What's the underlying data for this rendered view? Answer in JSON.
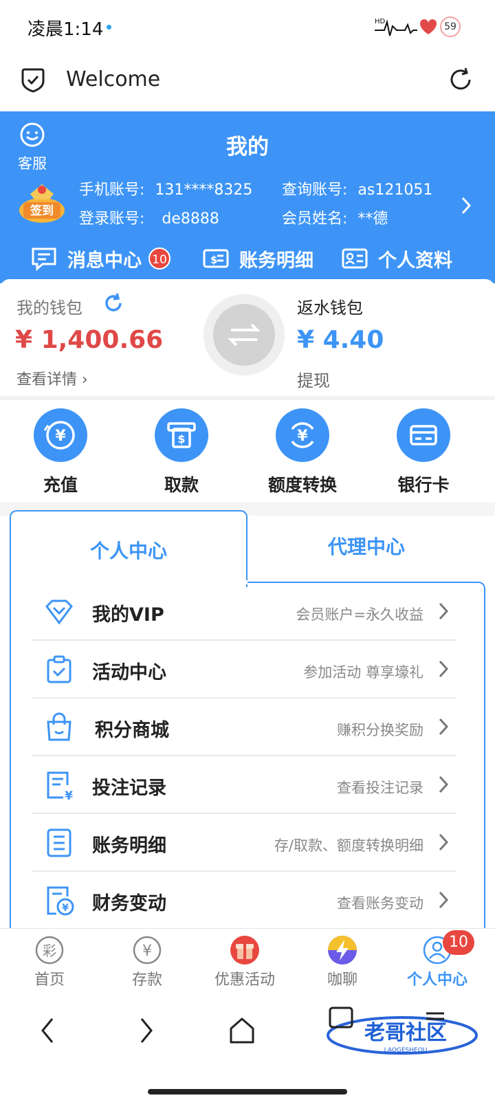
{
  "status_bar": {
    "time": "凌晨1:14",
    "battery": "59"
  },
  "browser": {
    "title": "Welcome"
  },
  "header": {
    "title": "我的",
    "service_label": "客服",
    "signin_label": "签到",
    "phone_label": "手机账号:",
    "phone_value": "131****8325",
    "query_label": "查询账号:",
    "query_value": "as121051",
    "login_label": "登录账号:",
    "login_value": "de8888",
    "name_label": "会员姓名:",
    "name_value": "**德",
    "quick_links": [
      {
        "label": "消息中心",
        "badge": "10"
      },
      {
        "label": "账务明细"
      },
      {
        "label": "个人资料"
      }
    ]
  },
  "wallet": {
    "main_label": "我的钱包",
    "main_amount": "¥ 1,400.66",
    "main_link": "查看详情",
    "rebate_label": "返水钱包",
    "rebate_amount": "¥ 4.40",
    "rebate_link": "提现"
  },
  "actions": [
    {
      "label": "充值",
      "icon": "deposit-icon"
    },
    {
      "label": "取款",
      "icon": "atm-icon"
    },
    {
      "label": "额度转换",
      "icon": "exchange-icon"
    },
    {
      "label": "银行卡",
      "icon": "bank-card-icon"
    }
  ],
  "tabs": [
    {
      "label": "个人中心"
    },
    {
      "label": "代理中心"
    }
  ],
  "menu": [
    {
      "title": "我的VIP",
      "subtitle": "会员账户=永久收益",
      "icon": "vip-diamond-icon"
    },
    {
      "title": "活动中心",
      "subtitle": "参加活动 尊享壕礼",
      "icon": "activity-clipboard-icon"
    },
    {
      "title": "积分商城",
      "subtitle": "赚积分换奖励",
      "icon": "shopping-bag-icon"
    },
    {
      "title": "投注记录",
      "subtitle": "查看投注记录",
      "icon": "bet-record-icon"
    },
    {
      "title": "账务明细",
      "subtitle": "存/取款、额度转换明细",
      "icon": "ledger-icon"
    },
    {
      "title": "财务变动",
      "subtitle": "查看账务变动",
      "icon": "finance-change-icon"
    }
  ],
  "bottom_nav": [
    {
      "label": "首页",
      "icon": "lottery-icon"
    },
    {
      "label": "存款",
      "icon": "yuan-icon"
    },
    {
      "label": "优惠活动",
      "icon": "gift-icon"
    },
    {
      "label": "咖聊",
      "icon": "lightning-icon"
    },
    {
      "label": "个人中心",
      "icon": "user-icon",
      "badge": "10",
      "active": true
    }
  ],
  "colors": {
    "brand_blue": "#3d94f6",
    "amount_red": "#e04848",
    "badge_red": "#e8473f"
  }
}
